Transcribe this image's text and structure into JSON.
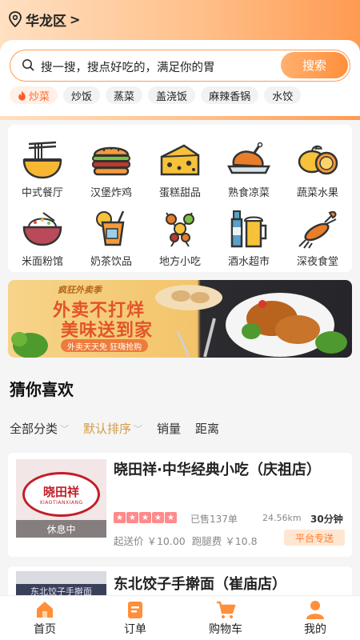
{
  "location": {
    "name": "华龙区",
    "arrow": ">"
  },
  "search": {
    "placeholder": "搜一搜，搜点好吃的，满足你的胃",
    "button": "搜索"
  },
  "hot_tags": [
    "炒菜",
    "炒饭",
    "蒸菜",
    "盖浇饭",
    "麻辣香锅",
    "水饺"
  ],
  "categories": [
    {
      "label": "中式餐厅",
      "icon": "noodle-bowl-icon"
    },
    {
      "label": "汉堡炸鸡",
      "icon": "burger-icon"
    },
    {
      "label": "蛋糕甜品",
      "icon": "cheese-cake-icon"
    },
    {
      "label": "熟食凉菜",
      "icon": "roast-chicken-icon"
    },
    {
      "label": "蔬菜水果",
      "icon": "lemon-icon"
    },
    {
      "label": "米面粉馆",
      "icon": "rice-bowl-icon"
    },
    {
      "label": "奶茶饮品",
      "icon": "juice-icon"
    },
    {
      "label": "地方小吃",
      "icon": "skewer-icon"
    },
    {
      "label": "酒水超市",
      "icon": "beer-icon"
    },
    {
      "label": "深夜食堂",
      "icon": "lobster-icon"
    }
  ],
  "banner": {
    "badge": "疯狂外卖季",
    "line1": "外卖不打烊",
    "line2": "美味送到家",
    "sub": "外卖天天免 狂嗨抢购"
  },
  "section_title": "猜你喜欢",
  "filters": {
    "all": "全部分类",
    "default_sort": "默认排序",
    "sales": "销量",
    "distance": "距离"
  },
  "shops": [
    {
      "name": "晓田祥·中华经典小吃（庆祖店）",
      "logo_text": "晓田祥",
      "logo_pinyin": "XIAOTIANXIANG",
      "status": "休息中",
      "rating": 5,
      "sold": "已售137单",
      "distance": "24.56km",
      "time": "30分钟",
      "min_order": "起送价 ￥10.00",
      "run_fee": "跑腿费 ￥10.8",
      "delivery": "平台专送"
    },
    {
      "name": "东北饺子手擀面（崔庙店）",
      "sign_text": "东北饺子手擀面"
    }
  ],
  "tabbar": [
    {
      "label": "首页",
      "icon": "home-icon"
    },
    {
      "label": "订单",
      "icon": "order-icon"
    },
    {
      "label": "购物车",
      "icon": "cart-icon"
    },
    {
      "label": "我的",
      "icon": "profile-icon"
    }
  ],
  "colors": {
    "accent": "#ff8f3a",
    "brand_red": "#c21e27",
    "active_filter": "#d39a47"
  }
}
